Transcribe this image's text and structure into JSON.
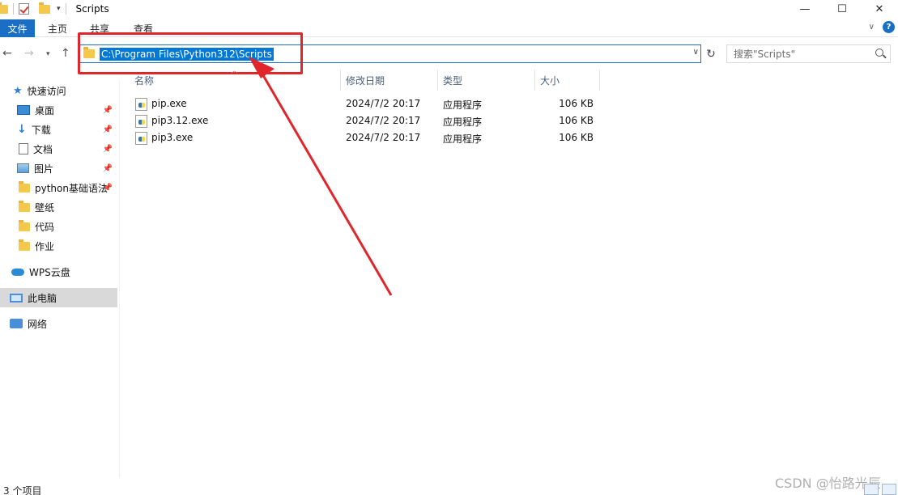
{
  "window": {
    "title": "Scripts"
  },
  "ribbon": {
    "tabs": [
      "文件",
      "主页",
      "共享",
      "查看"
    ]
  },
  "address": {
    "path": "C:\\Program Files\\Python312\\Scripts"
  },
  "search": {
    "placeholder": "搜索\"Scripts\""
  },
  "sidebar": {
    "items": [
      {
        "label": "快速访问",
        "icon": "star-icon",
        "pinned": false
      },
      {
        "label": "桌面",
        "icon": "desktop-icon",
        "pinned": true
      },
      {
        "label": "下载",
        "icon": "download-icon",
        "pinned": true
      },
      {
        "label": "文档",
        "icon": "document-icon",
        "pinned": true
      },
      {
        "label": "图片",
        "icon": "picture-icon",
        "pinned": true
      },
      {
        "label": "python基础语法",
        "icon": "folder-icon",
        "pinned": true
      },
      {
        "label": "壁纸",
        "icon": "folder-icon",
        "pinned": false
      },
      {
        "label": "代码",
        "icon": "folder-icon",
        "pinned": false
      },
      {
        "label": "作业",
        "icon": "folder-icon",
        "pinned": false
      },
      {
        "label": "WPS云盘",
        "icon": "cloud-icon",
        "pinned": false
      },
      {
        "label": "此电脑",
        "icon": "computer-icon",
        "pinned": false,
        "selected": true
      },
      {
        "label": "网络",
        "icon": "network-icon",
        "pinned": false
      }
    ]
  },
  "columns": {
    "name": "名称",
    "modified": "修改日期",
    "type": "类型",
    "size": "大小"
  },
  "files": [
    {
      "name": "pip.exe",
      "modified": "2024/7/2 20:17",
      "type": "应用程序",
      "size": "106 KB"
    },
    {
      "name": "pip3.12.exe",
      "modified": "2024/7/2 20:17",
      "type": "应用程序",
      "size": "106 KB"
    },
    {
      "name": "pip3.exe",
      "modified": "2024/7/2 20:17",
      "type": "应用程序",
      "size": "106 KB"
    }
  ],
  "status": {
    "count": "3 个项目"
  },
  "watermark": "CSDN @怡路光辰",
  "colors": {
    "accent": "#1a6fc4",
    "annotation": "#e0262b"
  }
}
